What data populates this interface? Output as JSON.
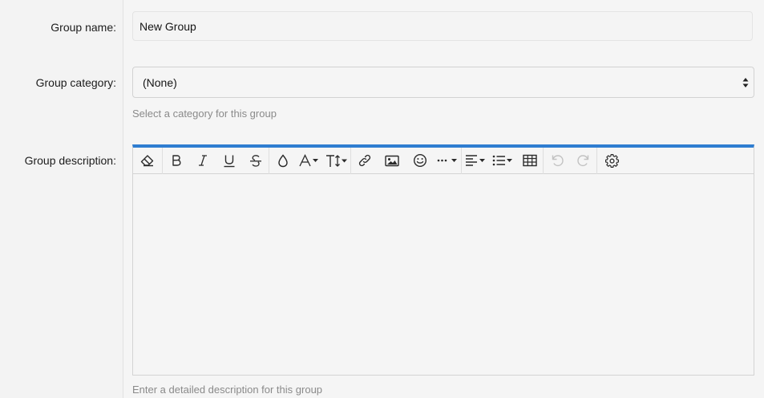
{
  "form": {
    "group_name": {
      "label": "Group name:",
      "value": "New Group"
    },
    "group_category": {
      "label": "Group category:",
      "selected": "(None)",
      "hint": "Select a category for this group"
    },
    "group_description": {
      "label": "Group description:",
      "hint": "Enter a detailed description for this group",
      "value": ""
    }
  },
  "editor": {
    "accent_color": "#2f7dd1",
    "toolbar": [
      {
        "icon": "eraser-icon",
        "title": "Remove formatting"
      },
      {
        "icon": "bold-icon",
        "title": "Bold"
      },
      {
        "icon": "italic-icon",
        "title": "Italic"
      },
      {
        "icon": "underline-icon",
        "title": "Underline"
      },
      {
        "icon": "strikethrough-icon",
        "title": "Strike"
      },
      {
        "icon": "text-color-icon",
        "title": "Text color"
      },
      {
        "icon": "font-family-icon",
        "title": "Font family"
      },
      {
        "icon": "font-size-icon",
        "title": "Font size"
      },
      {
        "icon": "link-icon",
        "title": "Link"
      },
      {
        "icon": "image-icon",
        "title": "Image"
      },
      {
        "icon": "smiley-icon",
        "title": "Smilies"
      },
      {
        "icon": "more-icon",
        "title": "More"
      },
      {
        "icon": "align-icon",
        "title": "Alignment"
      },
      {
        "icon": "list-icon",
        "title": "List"
      },
      {
        "icon": "table-icon",
        "title": "Table"
      },
      {
        "icon": "undo-icon",
        "title": "Undo"
      },
      {
        "icon": "redo-icon",
        "title": "Redo"
      },
      {
        "icon": "gear-icon",
        "title": "Options"
      }
    ]
  }
}
